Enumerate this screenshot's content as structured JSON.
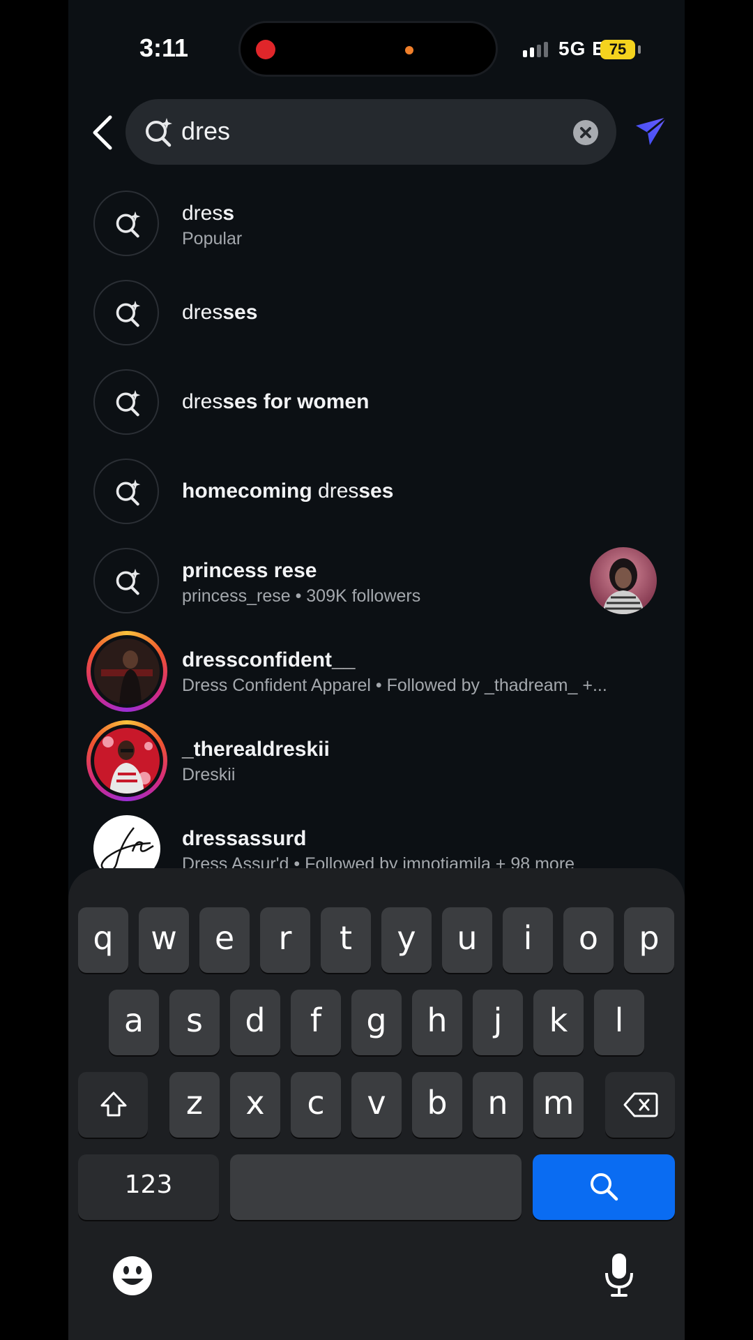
{
  "status_bar": {
    "time": "3:11",
    "network": "5G E",
    "battery": "75"
  },
  "search": {
    "query": "dres"
  },
  "results": [
    {
      "type": "query",
      "title_parts": [
        [
          "dres",
          false
        ],
        [
          "s",
          true
        ]
      ],
      "subtitle": "Popular"
    },
    {
      "type": "query",
      "title_parts": [
        [
          "dres",
          false
        ],
        [
          "ses",
          true
        ]
      ],
      "subtitle": ""
    },
    {
      "type": "query",
      "title_parts": [
        [
          "dres",
          false
        ],
        [
          "ses for women",
          true
        ]
      ],
      "subtitle": ""
    },
    {
      "type": "query",
      "title_parts": [
        [
          "homecoming ",
          true
        ],
        [
          "dres",
          false
        ],
        [
          "ses",
          true
        ]
      ],
      "subtitle": ""
    },
    {
      "type": "query",
      "title_parts": [
        [
          "princess rese",
          true
        ]
      ],
      "subtitle": "princess_rese • 309K followers",
      "has_avatar": true
    },
    {
      "type": "account",
      "title_parts": [
        [
          "dressconfident__",
          true
        ]
      ],
      "subtitle": "Dress Confident Apparel • Followed by _thadream_ +..."
    },
    {
      "type": "account",
      "title_parts": [
        [
          "_therealdreskii",
          true
        ]
      ],
      "subtitle": "Dreskii"
    },
    {
      "type": "account",
      "title_parts": [
        [
          "dressassurd",
          true
        ]
      ],
      "subtitle": "Dress Assur'd • Followed by imnotjamila + 98 more"
    }
  ],
  "keyboard": {
    "row1": [
      "q",
      "w",
      "e",
      "r",
      "t",
      "y",
      "u",
      "i",
      "o",
      "p"
    ],
    "row2": [
      "a",
      "s",
      "d",
      "f",
      "g",
      "h",
      "j",
      "k",
      "l"
    ],
    "row3": [
      "z",
      "x",
      "c",
      "v",
      "b",
      "n",
      "m"
    ],
    "numbers_label": "123",
    "icons": [
      "shift-icon",
      "backspace-icon",
      "search-icon",
      "emoji-icon",
      "microphone-icon"
    ]
  },
  "colors": {
    "background": "#0c1014",
    "accent": "#0a6cf2",
    "send": "#4a5bf5",
    "battery": "#f4d31e"
  }
}
